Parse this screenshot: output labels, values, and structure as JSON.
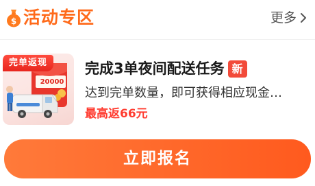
{
  "header": {
    "title": "活动专区",
    "more_label": "更多",
    "icon": "money-bag-icon",
    "accent_color": "#ff6a1a"
  },
  "activity": {
    "thumbnail": {
      "badge_text": "完单返现",
      "amount_text": "20000",
      "icon": "red-envelope-delivery-van-illustration"
    },
    "title": "完成3单夜间配送任务",
    "new_badge": "新",
    "description": "达到完单数量，即可获得相应现金…",
    "reward": "最高返66元",
    "reward_color": "#ff3b2f"
  },
  "cta": {
    "label": "立即报名",
    "color": "#ff6a2a"
  }
}
